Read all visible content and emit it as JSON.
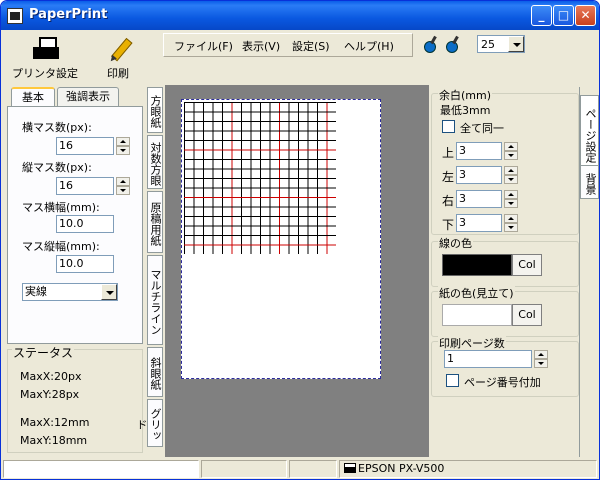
{
  "window": {
    "title": "PaperPrint"
  },
  "toolbar": {
    "printer_setup": "プリンタ設定",
    "print": "印刷",
    "zoom": "25"
  },
  "menu": [
    "ファイル(F)",
    "表示(V)",
    "設定(S)",
    "ヘルプ(H)"
  ],
  "left_tabs": [
    "基本",
    "強調表示"
  ],
  "fields": {
    "h_count_label": "横マス数(px):",
    "h_count": "16",
    "v_count_label": "縦マス数(px):",
    "v_count": "16",
    "cell_w_label": "マス横幅(mm):",
    "cell_w": "10.0",
    "cell_h_label": "マス縦幅(mm):",
    "cell_h": "10.0",
    "line_style": "実線"
  },
  "status": {
    "title": "ステータス",
    "maxx_px": "MaxX:20px",
    "maxy_px": "MaxY:28px",
    "maxx_mm": "MaxX:12mm",
    "maxy_mm": "MaxY:18mm"
  },
  "paper_tabs": [
    "方眼紙",
    "対数方眼",
    "原稿用紙",
    "マルチライン",
    "斜眼紙",
    "グリッド"
  ],
  "margin": {
    "title": "余白(mm)",
    "min": "最低3mm",
    "same_all": "全て同一",
    "top_label": "上",
    "top": "3",
    "left_label": "左",
    "left": "3",
    "right_label": "右",
    "right": "3",
    "bottom_label": "下",
    "bottom": "3"
  },
  "line_color": {
    "title": "線の色",
    "btn": "Col",
    "color": "#000000"
  },
  "paper_color": {
    "title": "紙の色(見立て)",
    "btn": "Col",
    "color": "#ffffff"
  },
  "pages": {
    "title": "印刷ページ数",
    "value": "1",
    "add_num": "ページ番号付加"
  },
  "right_tabs": [
    "ページ設定",
    "背景"
  ],
  "statusbar": {
    "printer": "EPSON PX-V500"
  },
  "colors": {
    "grid_line": "#000000",
    "grid_major": "#cc0000",
    "page_border": "#2b2b9c"
  }
}
